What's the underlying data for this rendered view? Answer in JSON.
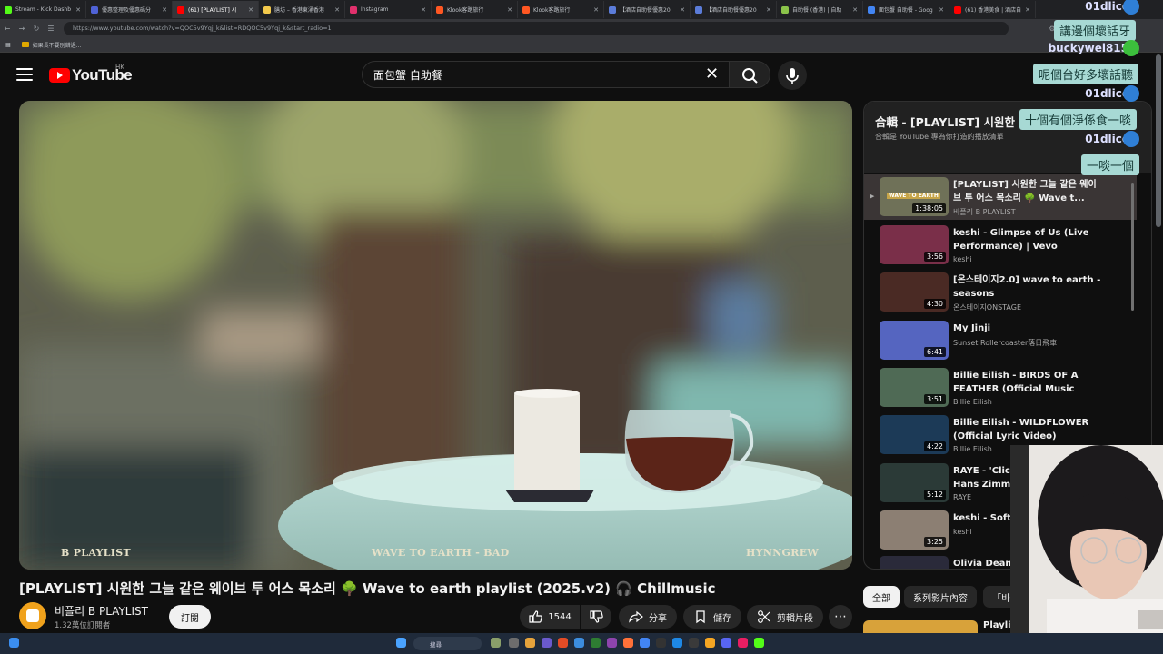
{
  "browser": {
    "tabs": [
      {
        "label": "Stream - Kick Dashb",
        "color": "#53fc18"
      },
      {
        "label": "優惠整理及優惠碼分",
        "color": "#4f62d6"
      },
      {
        "label": "(61) [PLAYLIST] 시",
        "color": "#ff0000",
        "active": true
      },
      {
        "label": "膳坊 – 香港東涌香港",
        "color": "#f2c94c"
      },
      {
        "label": "Instagram",
        "color": "#e1306c"
      },
      {
        "label": "Klook客路旅行",
        "color": "#ff5722"
      },
      {
        "label": "Klook客路旅行",
        "color": "#ff5722"
      },
      {
        "label": "【酒店自助餐優惠20",
        "color": "#5b7cd9"
      },
      {
        "label": "【酒店自助餐優惠20",
        "color": "#5b7cd9"
      },
      {
        "label": "自助餐 (香港) | 自助",
        "color": "#8bc34a"
      },
      {
        "label": "面包蟹 自助餐 - Goog",
        "color": "#4285f4"
      },
      {
        "label": "(61) 香港美食 | 酒店自",
        "color": "#ff0000"
      }
    ],
    "url": "https://www.youtube.com/watch?v=QOC5v9Yqj_k&list=RDQOC5v9Yqj_k&start_radio=1",
    "bookmark": "如果長不要別錯過..."
  },
  "header": {
    "logo_text": "YouTube",
    "region": "HK",
    "search_value": "面包蟹 自助餐"
  },
  "video": {
    "overlay_left": "B PLAYLIST",
    "overlay_center": "WAVE TO EARTH - BAD",
    "overlay_right": "HYNNGREW",
    "title": "[PLAYLIST] 시원한 그늘 같은 웨이브 투 어스 목소리 🌳 Wave to earth playlist (2025.v2) 🎧 Chillmusic",
    "channel": "비플리 B PLAYLIST",
    "subscribers": "1.32萬位訂閱者",
    "subscribe_label": "訂閱",
    "likes": "1544",
    "share_label": "分享",
    "save_label": "儲存",
    "clip_label": "剪輯片段"
  },
  "playlist": {
    "title": "合輯 - [PLAYLIST] 시원한 그늘",
    "subtitle": "合輯是 YouTube 專為你打造的播放清單",
    "items": [
      {
        "title": "[PLAYLIST] 시원한 그늘 같은 웨이브 투 어스 목소리 🌳 Wave t...",
        "channel": "비플리 B PLAYLIST",
        "duration": "1:38:05",
        "thumb": "#6f7158",
        "thumb_text": "WAVE TO EARTH"
      },
      {
        "title": "keshi - Glimpse of Us (Live Performance) | Vevo",
        "channel": "keshi",
        "duration": "3:56",
        "thumb": "#7a2f49"
      },
      {
        "title": "[온스테이지2.0] wave to earth - seasons",
        "channel": "온스테이지ONSTAGE",
        "duration": "4:30",
        "thumb": "#4a2a24"
      },
      {
        "title": "My Jinji",
        "channel": "Sunset Rollercoaster落日飛車",
        "duration": "6:41",
        "thumb": "#5565c0"
      },
      {
        "title": "Billie Eilish - BIRDS OF A FEATHER (Official Music Video)",
        "channel": "Billie Eilish",
        "duration": "3:51",
        "thumb": "#4f6a55"
      },
      {
        "title": "Billie Eilish - WILDFLOWER (Official Lyric Video)",
        "channel": "Billie Eilish",
        "duration": "4:22",
        "thumb": "#1c3a57"
      },
      {
        "title": "RAYE - 'Click Clack' feat. Hans Zimmer (",
        "channel": "RAYE",
        "duration": "5:12",
        "thumb": "#2b3a37"
      },
      {
        "title": "keshi - Soft S Video)",
        "channel": "keshi",
        "duration": "3:25",
        "thumb": "#8c7f73"
      },
      {
        "title": "Olivia Dean -",
        "channel": "",
        "duration": "",
        "thumb": "#2a2a3a"
      }
    ]
  },
  "chips": [
    "全部",
    "系列影片內容",
    "「비플"
  ],
  "next_up": "Playlis",
  "chat": [
    {
      "type": "msg",
      "text": "講邊個壞話牙"
    },
    {
      "type": "user",
      "text": "buckywei815"
    },
    {
      "type": "msg",
      "text": "呢個台好多壞話聽"
    },
    {
      "type": "user",
      "text": "01dlicc"
    },
    {
      "type": "msg",
      "text": "十個有個淨係食一啖"
    },
    {
      "type": "user",
      "text": "01dlicc"
    },
    {
      "type": "msg",
      "text": "一啖一個"
    },
    {
      "type": "user",
      "text": "01dlicc"
    }
  ],
  "taskbar": {
    "search_label": "搜尋"
  }
}
